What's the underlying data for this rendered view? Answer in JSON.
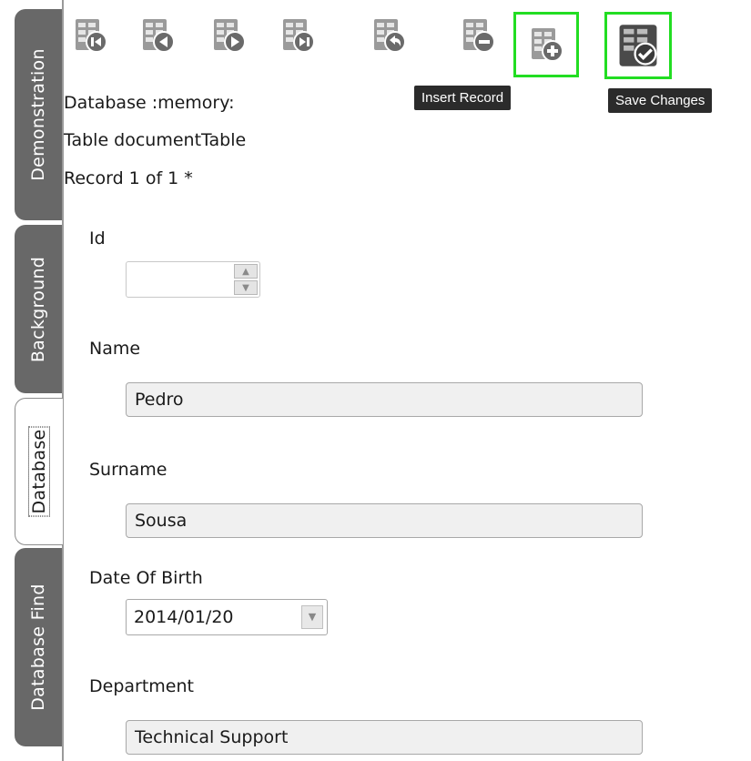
{
  "tabs": [
    {
      "label": "Demonstration",
      "active": false
    },
    {
      "label": "Background",
      "active": false
    },
    {
      "label": "Database",
      "active": true
    },
    {
      "label": "Database Find",
      "active": false
    }
  ],
  "toolbar": {
    "buttons": [
      {
        "name": "first-record-button",
        "icon": "first-record-icon"
      },
      {
        "name": "previous-record-button",
        "icon": "previous-record-icon"
      },
      {
        "name": "next-record-button",
        "icon": "next-record-icon"
      },
      {
        "name": "last-record-button",
        "icon": "last-record-icon"
      },
      {
        "name": "undo-changes-button",
        "icon": "undo-icon"
      },
      {
        "name": "delete-record-button",
        "icon": "minus-icon"
      },
      {
        "name": "insert-record-button",
        "icon": "plus-icon",
        "tooltip": "Insert Record"
      },
      {
        "name": "save-changes-button",
        "icon": "check-icon",
        "tooltip": "Save Changes"
      }
    ],
    "highlight_color": "#22dd22"
  },
  "info": {
    "database": "Database :memory:",
    "table": "Table documentTable",
    "record": "Record 1 of 1 *"
  },
  "form": {
    "id_label": "Id",
    "id_value": "",
    "name_label": "Name",
    "name_value": "Pedro",
    "surname_label": "Surname",
    "surname_value": "Sousa",
    "dob_label": "Date Of Birth",
    "dob_value": "2014/01/20",
    "department_label": "Department",
    "department_value": "Technical Support"
  }
}
